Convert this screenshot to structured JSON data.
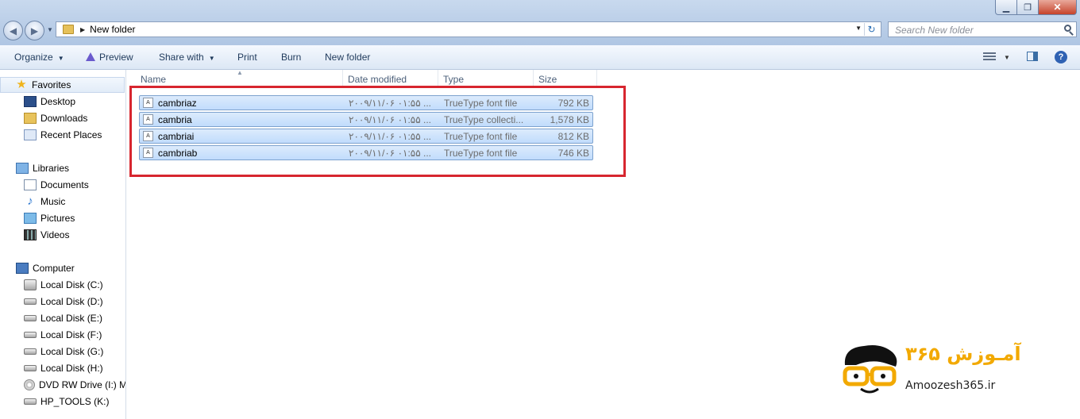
{
  "window": {
    "controls": {
      "minimize": "▁",
      "maximize": "❐",
      "close": "✕"
    }
  },
  "addressbar": {
    "crumb": "New folder",
    "search_placeholder": "Search New folder"
  },
  "toolbar": {
    "organize": "Organize",
    "preview": "Preview",
    "share_with": "Share with",
    "print": "Print",
    "burn": "Burn",
    "new_folder": "New folder"
  },
  "navpane": {
    "favorites": "Favorites",
    "favorites_items": [
      "Desktop",
      "Downloads",
      "Recent Places"
    ],
    "libraries": "Libraries",
    "libraries_items": [
      "Documents",
      "Music",
      "Pictures",
      "Videos"
    ],
    "computer": "Computer",
    "computer_items": [
      "Local Disk (C:)",
      "Local Disk (D:)",
      "Local Disk (E:)",
      "Local Disk (F:)",
      "Local Disk (G:)",
      "Local Disk (H:)",
      "DVD RW Drive (I:) My",
      "HP_TOOLS (K:)"
    ]
  },
  "columns": {
    "name": "Name",
    "date": "Date modified",
    "type": "Type",
    "size": "Size"
  },
  "files": [
    {
      "name": "cambriaz",
      "date": "۲۰۰۹/۱۱/۰۶ ۰۱:۵۵ ...",
      "type": "TrueType font file",
      "size": "792 KB"
    },
    {
      "name": "cambria",
      "date": "۲۰۰۹/۱۱/۰۶ ۰۱:۵۵ ...",
      "type": "TrueType collecti...",
      "size": "1,578 KB"
    },
    {
      "name": "cambriai",
      "date": "۲۰۰۹/۱۱/۰۶ ۰۱:۵۵ ...",
      "type": "TrueType font file",
      "size": "812 KB"
    },
    {
      "name": "cambriab",
      "date": "۲۰۰۹/۱۱/۰۶ ۰۱:۵۵ ...",
      "type": "TrueType font file",
      "size": "746 KB"
    }
  ],
  "file_icon_glyph": "A",
  "watermark": {
    "fa": "آمـوزش ۳۶۵",
    "site": "Amoozesh365.ir"
  },
  "colors": {
    "highlight_box": "#d7262f",
    "selection": "#c1dcfc",
    "logo_accent": "#f2a900"
  }
}
